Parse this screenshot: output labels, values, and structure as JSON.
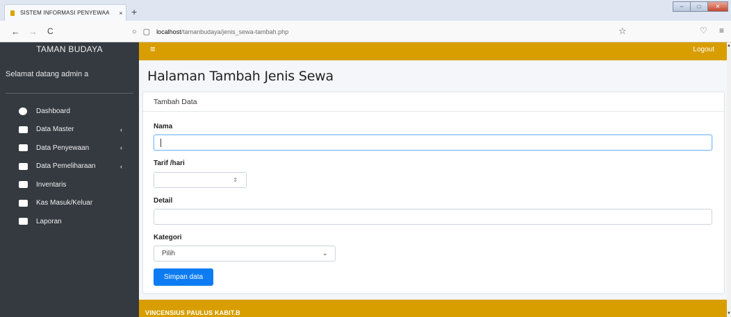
{
  "browser": {
    "tab_title": "SISTEM INFORMASI PENYEWAA",
    "tab_close": "×",
    "new_tab": "+",
    "url_host": "localhost",
    "url_path": "/tamanbudaya/jenis_sewa-tambah.php",
    "back": "←",
    "forward": "→",
    "reload": "C",
    "star": "☆",
    "pocket": "♡",
    "menu": "≡",
    "win_min": "–",
    "win_max": "□",
    "win_close": "✕"
  },
  "sidebar": {
    "brand": "TAMAN BUDAYA",
    "welcome": "Selamat datang admin a",
    "items": [
      {
        "label": "Dashboard",
        "chevron": ""
      },
      {
        "label": "Data Master",
        "chevron": "‹"
      },
      {
        "label": "Data Penyewaan",
        "chevron": "‹"
      },
      {
        "label": "Data Pemeliharaan",
        "chevron": "‹"
      },
      {
        "label": "Inventaris",
        "chevron": ""
      },
      {
        "label": "Kas Masuk/Keluar",
        "chevron": ""
      },
      {
        "label": "Laporan",
        "chevron": ""
      }
    ]
  },
  "topnav": {
    "hamburger": "≡",
    "logout": "Logout"
  },
  "main": {
    "title": "Halaman Tambah Jenis Sewa",
    "card_header": "Tambah Data",
    "form": {
      "nama_label": "Nama",
      "nama_value": "",
      "tarif_label": "Tarif /hari",
      "tarif_value": "",
      "detail_label": "Detail",
      "detail_value": "",
      "kategori_label": "Kategori",
      "kategori_selected": "Pilih",
      "submit_label": "Simpan data"
    }
  },
  "footer": {
    "text": "VINCENSIUS PAULUS KABIT.B"
  },
  "colors": {
    "accent": "#d89e00",
    "sidebar": "#343a40",
    "primary_button": "#0d7cf2"
  }
}
